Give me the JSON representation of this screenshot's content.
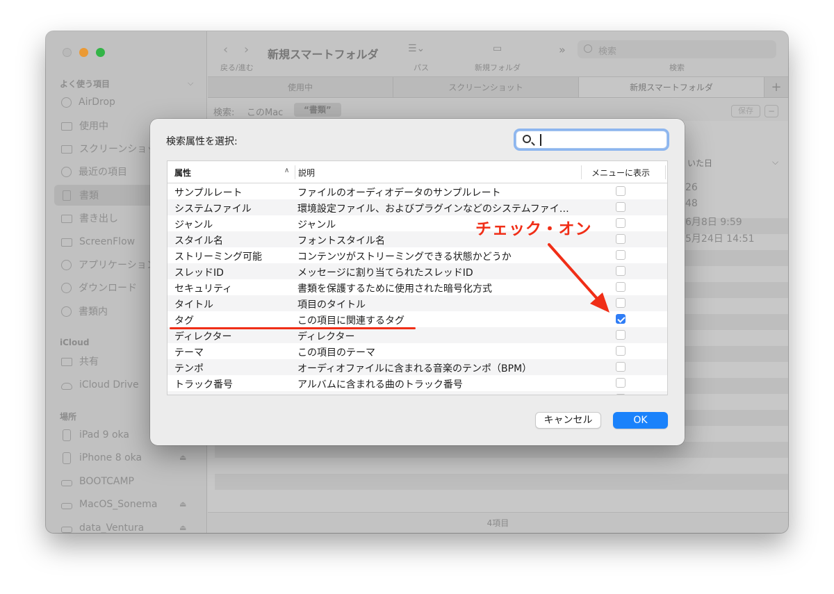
{
  "window": {
    "title": "新規スマートフォルダ",
    "back_forward_label": "戻る/進む",
    "path_label": "パス",
    "new_folder_label": "新規フォルダ",
    "search_placeholder": "検索",
    "search_label": "検索",
    "tabs": [
      "使用中",
      "スクリーンショット",
      "新規スマートフォルダ"
    ],
    "scope": {
      "label": "検索:",
      "this_mac": "このMac",
      "selected": "“書類”"
    },
    "save_label": "保存",
    "column_partial": "いた日",
    "dates": [
      "26",
      "48",
      "6月8日 9:59",
      "5月24日 14:51"
    ],
    "status": "4項目"
  },
  "sidebar": {
    "favorites_header": "よく使う項目",
    "favorites": [
      {
        "label": "AirDrop",
        "icon": "airdrop-icon"
      },
      {
        "label": "使用中",
        "icon": "folder-icon"
      },
      {
        "label": "スクリーンショット",
        "icon": "folder-icon"
      },
      {
        "label": "最近の項目",
        "icon": "clock-icon"
      },
      {
        "label": "書類",
        "icon": "document-icon",
        "selected": true
      },
      {
        "label": "書き出し",
        "icon": "folder-icon"
      },
      {
        "label": "ScreenFlow",
        "icon": "folder-icon"
      },
      {
        "label": "アプリケーション",
        "icon": "applications-icon"
      },
      {
        "label": "ダウンロード",
        "icon": "download-icon"
      },
      {
        "label": "書類内",
        "icon": "gear-icon"
      }
    ],
    "icloud_header": "iCloud",
    "icloud": [
      {
        "label": "共有",
        "icon": "shared-folder-icon"
      },
      {
        "label": "iCloud Drive",
        "icon": "cloud-icon"
      }
    ],
    "locations_header": "場所",
    "locations": [
      {
        "label": "iPad 9 oka",
        "icon": "ipad-icon"
      },
      {
        "label": "iPhone 8 oka",
        "icon": "iphone-icon",
        "eject": true
      },
      {
        "label": "BOOTCAMP",
        "icon": "drive-icon"
      },
      {
        "label": "MacOS_Sonema",
        "icon": "drive-icon",
        "eject": true
      },
      {
        "label": "data_Ventura",
        "icon": "drive-icon",
        "eject": true
      }
    ]
  },
  "dialog": {
    "title": "検索属性を選択:",
    "search_value": "",
    "columns": {
      "attribute": "属性",
      "description": "説明",
      "show_in_menu": "メニューに表示"
    },
    "rows": [
      {
        "attr": "サンプルレート",
        "desc": "ファイルのオーディオデータのサンプルレート",
        "checked": false
      },
      {
        "attr": "システムファイル",
        "desc": "環境設定ファイル、およびプラグインなどのシステムファイ…",
        "checked": false
      },
      {
        "attr": "ジャンル",
        "desc": "ジャンル",
        "checked": false
      },
      {
        "attr": "スタイル名",
        "desc": "フォントスタイル名",
        "checked": false
      },
      {
        "attr": "ストリーミング可能",
        "desc": "コンテンツがストリーミングできる状態かどうか",
        "checked": false
      },
      {
        "attr": "スレッドID",
        "desc": "メッセージに割り当てられたスレッドID",
        "checked": false
      },
      {
        "attr": "セキュリティ",
        "desc": "書類を保護するために使用された暗号化方式",
        "checked": false
      },
      {
        "attr": "タイトル",
        "desc": "項目のタイトル",
        "checked": false
      },
      {
        "attr": "タグ",
        "desc": "この項目に関連するタグ",
        "checked": true
      },
      {
        "attr": "ディレクター",
        "desc": "ディレクター",
        "checked": false
      },
      {
        "attr": "テーマ",
        "desc": "この項目のテーマ",
        "checked": false
      },
      {
        "attr": "テンポ",
        "desc": "オーディオファイルに含まれる音楽のテンポ（BPM）",
        "checked": false
      },
      {
        "attr": "トラック番号",
        "desc": "アルバムに含まれる曲のトラック番号",
        "checked": false
      },
      {
        "attr": "",
        "desc": "",
        "checked": false
      }
    ],
    "cancel_label": "キャンセル",
    "ok_label": "OK"
  },
  "annotation": {
    "label": "チェック・オン",
    "color": "#f02e17"
  }
}
